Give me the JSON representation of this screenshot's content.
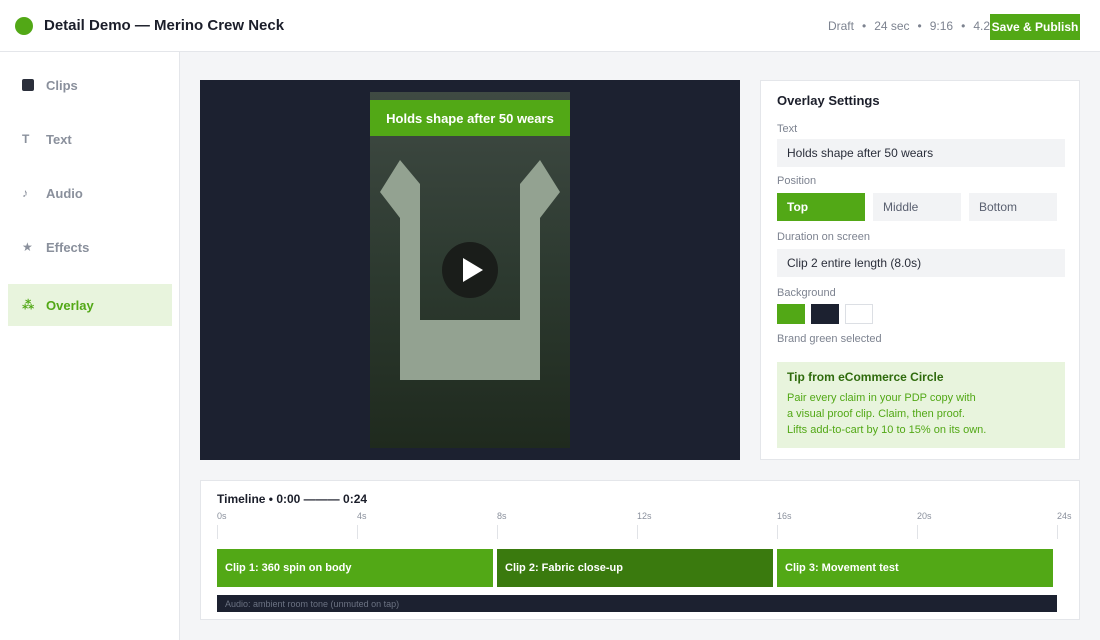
{
  "header": {
    "title": "Detail Demo — Merino Crew Neck",
    "meta": [
      "Draft",
      "24 sec",
      "9:16",
      "4.2"
    ],
    "meta_separator": "•",
    "publish_label": "Save & Publish",
    "brand_color": "#52a816"
  },
  "sidebar": {
    "items": [
      {
        "label": "Clips",
        "icon": "square-icon",
        "glyph": ""
      },
      {
        "label": "Text",
        "icon": "text-icon",
        "glyph": "T"
      },
      {
        "label": "Audio",
        "icon": "music-note-icon",
        "glyph": "♪"
      },
      {
        "label": "Effects",
        "icon": "star-icon",
        "glyph": "★"
      },
      {
        "label": "Overlay",
        "icon": "dots-icon",
        "glyph": "⁂"
      }
    ],
    "active": "Overlay"
  },
  "preview": {
    "overlay_text": "Holds shape after 50 wears",
    "play_icon": "play-icon"
  },
  "settings": {
    "title": "Overlay Settings",
    "text_label": "Text",
    "text_value": "Holds shape after 50 wears",
    "position_label": "Position",
    "positions": [
      "Top",
      "Middle",
      "Bottom"
    ],
    "position_selected": "Top",
    "duration_label": "Duration on screen",
    "duration_value": "Clip 2 entire length (8.0s)",
    "background_label": "Background",
    "swatches": [
      "#52a816",
      "#1c2130",
      "#ffffff"
    ],
    "background_note": "Brand green selected",
    "tip": {
      "title": "Tip from eCommerce Circle",
      "lines": [
        "Pair every claim in your PDP copy with",
        "a visual proof clip. Claim, then proof.",
        "Lifts add-to-cart by 10 to 15% on its own."
      ]
    }
  },
  "timeline": {
    "title": "Timeline  •  0:00 ——— 0:24",
    "ticks": [
      "0s",
      "4s",
      "8s",
      "12s",
      "16s",
      "20s",
      "24s"
    ],
    "clips": [
      {
        "label": "Clip 1: 360 spin on body",
        "color": "#52a816"
      },
      {
        "label": "Clip 2: Fabric close-up",
        "color": "#3a7a0e"
      },
      {
        "label": "Clip 3: Movement test",
        "color": "#52a816"
      }
    ],
    "audio_label": "Audio: ambient room tone (unmuted on tap)"
  }
}
